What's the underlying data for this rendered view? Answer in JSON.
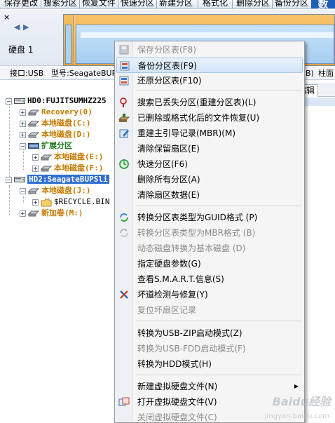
{
  "toolbar": {
    "items": [
      "保存更改",
      "搜索分区",
      "恢复文件",
      "快速分区",
      "新建分区",
      "格式化",
      "删除分区",
      "备份分区"
    ],
    "brand": "数"
  },
  "disk_panel": {
    "close": "×",
    "nav_left": "◀",
    "nav_right": "▶",
    "label": "硬盘 1"
  },
  "info_row": {
    "interface": "接口:USB",
    "model": "型号:SeagateBUP",
    "partial": "B)",
    "cylinders": "柱面"
  },
  "tabs": {
    "edit": "编辑"
  },
  "tree": {
    "disk0": "HD0:FUJITSUMHZ225",
    "disk0_parts": [
      "Recovery(0)",
      "本地磁盘(C:)",
      "本地磁盘(D:)"
    ],
    "ext": "扩展分区",
    "ext_parts": [
      "本地磁盘(E:)",
      "本地磁盘(F:)"
    ],
    "disk2": "HD2:SeagateBUPSli",
    "disk2_part": "本地磁盘(J:)",
    "folder": "$RECYCLE.BIN",
    "new_vol": "新加卷(M:)"
  },
  "context_menu": {
    "items": [
      {
        "label": "保存分区表(F8)",
        "disabled": true,
        "icon": "save-icon"
      },
      {
        "label": "备份分区表(F9)",
        "highlighted": true,
        "icon": "backup-icon"
      },
      {
        "label": "还原分区表(F10)",
        "icon": "restore-icon"
      },
      {
        "label": "搜索已丢失分区(重建分区表)(L)",
        "icon": "search-icon"
      },
      {
        "label": "已删除或格式化后的文件恢复(U)",
        "icon": "recover-icon"
      },
      {
        "label": "重建主引导记录(MBR)(M)",
        "icon": "edit-icon"
      },
      {
        "label": "清除保留扇区(E)"
      },
      {
        "label": "快速分区(F6)",
        "icon": "quick-partition-icon"
      },
      {
        "label": "删除所有分区(A)"
      },
      {
        "label": "清除扇区数据(E)"
      },
      {
        "label": "转换分区表类型为GUID格式 (P)",
        "icon": "convert-icon"
      },
      {
        "label": "转换分区表类型为MBR格式 (B)",
        "disabled": true,
        "icon": "convert-icon"
      },
      {
        "label": "动态磁盘转换为基本磁盘 (D)",
        "disabled": true
      },
      {
        "label": "指定硬盘参数(G)"
      },
      {
        "label": "查看S.M.A.R.T.信息(S)"
      },
      {
        "label": "坏道检测与修复(Y)",
        "icon": "tools-icon"
      },
      {
        "label": "复位坏扇区记录",
        "disabled": true
      },
      {
        "label": "转换为USB-ZIP启动模式(Z)"
      },
      {
        "label": "转换为USB-FDD启动模式(F)",
        "disabled": true
      },
      {
        "label": "转换为HDD模式(H)"
      },
      {
        "label": "新建虚拟硬盘文件(N)",
        "submenu": true
      },
      {
        "label": "打开虚拟硬盘文件(V)",
        "icon": "open-vdisk-icon"
      },
      {
        "label": "关闭虚拟硬盘文件(C)",
        "disabled": true
      }
    ]
  },
  "watermark": {
    "text": "Baidu经验",
    "sub": "jingyan.baidu.com"
  },
  "colors": {
    "highlight": "#d4e5f8",
    "partition_orange": "#e9a53a",
    "partition_blue": "#a6cef2",
    "tree_selected": "#2f6fd1"
  }
}
